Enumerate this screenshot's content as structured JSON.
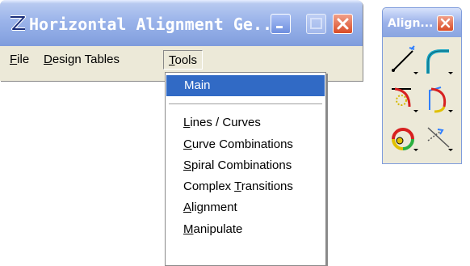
{
  "main_window": {
    "title": "Horizontal Alignment Ge...",
    "menu": {
      "file": "File",
      "design_tables": "Design Tables",
      "tools": "Tools"
    }
  },
  "tools_menu": {
    "items": [
      {
        "label": "Main",
        "selected": true
      },
      {
        "label": "Lines / Curves"
      },
      {
        "label": "Curve Combinations"
      },
      {
        "label": "Spiral Combinations"
      },
      {
        "label": "Complex Transitions"
      },
      {
        "label": "Alignment"
      },
      {
        "label": "Manipulate"
      }
    ]
  },
  "tool_window": {
    "title": "Align...",
    "buttons": [
      {
        "icon": "line-tool-icon"
      },
      {
        "icon": "curve-tool-icon"
      },
      {
        "icon": "spiral-curve-icon"
      },
      {
        "icon": "complex-curve-icon"
      },
      {
        "icon": "alignment-icon"
      },
      {
        "icon": "manipulate-icon"
      }
    ]
  },
  "colors": {
    "title_blue": "#8aa6e2",
    "menu_highlight": "#316ac5",
    "close_red": "#d94b26"
  }
}
